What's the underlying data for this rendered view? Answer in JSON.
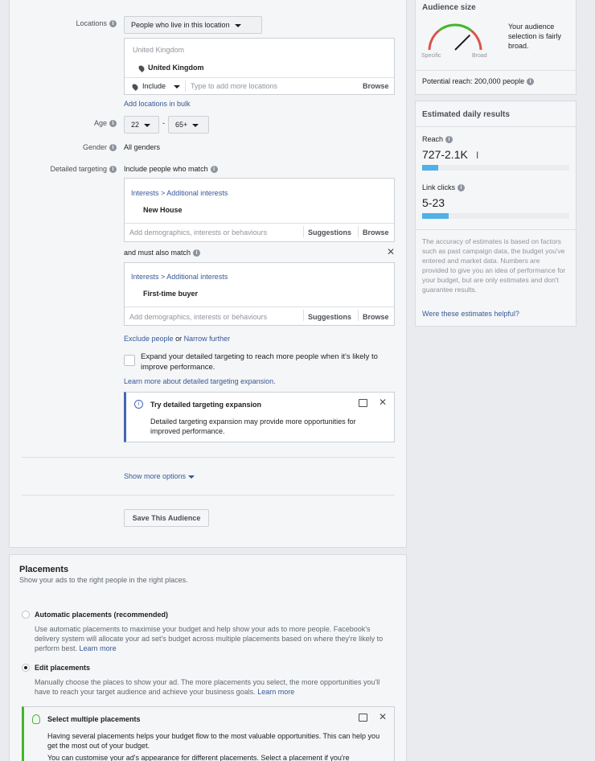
{
  "locations": {
    "label": "Locations",
    "dropdown": "People who live in this location",
    "group_header": "United Kingdom",
    "selected": "United Kingdom",
    "include_label": "Include",
    "input_placeholder": "Type to add more locations",
    "browse": "Browse",
    "bulk_link": "Add locations in bulk"
  },
  "age": {
    "label": "Age",
    "min": "22",
    "max": "65+",
    "dash": "-"
  },
  "gender": {
    "label": "Gender",
    "value": "All genders"
  },
  "detailed": {
    "label": "Detailed targeting",
    "include_match": "Include people who match",
    "box1_path": "Interests > Additional interests",
    "box1_item": "New House",
    "placeholder": "Add demographics, interests or behaviours",
    "suggestions": "Suggestions",
    "browse": "Browse",
    "must_match": "and must also match",
    "box2_path": "Interests > Additional interests",
    "box2_item": "First-time buyer",
    "exclude": "Exclude people",
    "or": "or",
    "narrow": "Narrow further",
    "expand_label": "Expand your detailed targeting to reach more people when it's likely to improve performance.",
    "learn_more": "Learn more about detailed targeting expansion.",
    "tip_title": "Try detailed targeting expansion",
    "tip_body": "Detailed targeting expansion may provide more opportunities for improved performance."
  },
  "show_more": "Show more options",
  "save_audience": "Save This Audience",
  "placements": {
    "title": "Placements",
    "subtitle": "Show your ads to the right people in the right places.",
    "auto_title": "Automatic placements (recommended)",
    "auto_desc": "Use automatic placements to maximise your budget and help show your ads to more people. Facebook's delivery system will allocate your ad set's budget across multiple placements based on where they're likely to perform best.",
    "auto_link": "Learn more",
    "edit_title": "Edit placements",
    "edit_desc": "Manually choose the places to show your ad. The more placements you select, the more opportunities you'll have to reach your target audience and achieve your business goals.",
    "edit_link": "Learn more",
    "tip_title": "Select multiple placements",
    "tip_body": "Having several placements helps your budget flow to the most valuable opportunities. This can help you get the most out of your budget.",
    "tip_body2": "You can customise your ad's appearance for different placements. Select a placement if you're"
  },
  "audience": {
    "title": "Audience size",
    "specific": "Specific",
    "broad": "Broad",
    "gauge_level": 0.75,
    "desc": "Your audience selection is fairly broad.",
    "potential": "Potential reach: 200,000 people"
  },
  "estimates": {
    "title": "Estimated daily results",
    "reach_label": "Reach",
    "reach_value": "727-2.1K",
    "reach_fill": 0.11,
    "clicks_label": "Link clicks",
    "clicks_value": "5-23",
    "clicks_fill": 0.18,
    "note": "The accuracy of estimates is based on factors such as past campaign data, the budget you've entered and market data. Numbers are provided to give you an idea of performance for your budget, but are only estimates and don't guarantee results.",
    "helpful_link": "Were these estimates helpful?"
  },
  "colors": {
    "link": "#365899",
    "bar": "#4fb1e6",
    "tip_accent": "#4267b2",
    "tip_green": "#42b72a"
  }
}
